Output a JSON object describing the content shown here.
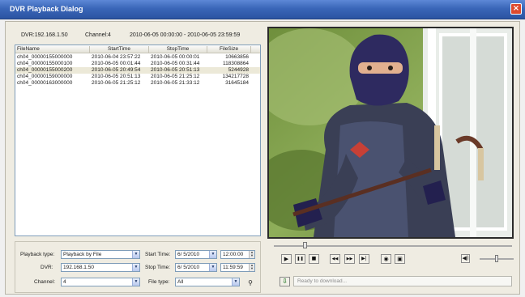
{
  "window": {
    "title": "DVR Playback Dialog",
    "close_glyph": "×"
  },
  "info": {
    "dvr": "DVR:192.168.1.50",
    "channel": "Channel:4",
    "range": "2010-06-05 00:00:00 - 2010-06-05 23:59:59"
  },
  "file_list": {
    "columns": [
      "FileName",
      "StartTime",
      "StopTime",
      "FileSize"
    ],
    "rows": [
      [
        "ch04_00000155000000",
        "2010-06-04 23:57:22",
        "2010-06-05 00:00:01",
        "10663856"
      ],
      [
        "ch04_00000155000100",
        "2010-06-05 00:01:44",
        "2010-06-05 00:31:44",
        "118308864"
      ],
      [
        "ch04_00000155000200",
        "2010-06-05 20:49:54",
        "2010-06-05 20:51:13",
        "5244928"
      ],
      [
        "ch04_00000159000000",
        "2010-06-05 20:51:13",
        "2010-06-05 21:25:12",
        "134217728"
      ],
      [
        "ch04_00000163000000",
        "2010-06-05 21:25:12",
        "2010-06-05 21:33:12",
        "31645184"
      ]
    ],
    "selected_row": 2
  },
  "search": {
    "playback_type_label": "Playback type:",
    "playback_type_value": "Playback by File",
    "dvr_label": "DVR:",
    "dvr_value": "192.168.1.50",
    "channel_label": "Channel:",
    "channel_value": "4",
    "start_time_label": "Start Time:",
    "start_date": "6/ 5/2010",
    "start_time": "12:00:00",
    "stop_time_label": "Stop Time:",
    "stop_date": "6/ 5/2010",
    "stop_time": "11:59:59",
    "file_type_label": "File type:",
    "file_type_value": "All",
    "search_glyph": "⚲"
  },
  "player": {
    "seek_fraction": 0.13,
    "volume_fraction": 0.5,
    "buttons": {
      "play": "▶",
      "pause": "❚❚",
      "stop": "■",
      "slow": "◀◀",
      "fast": "▶▶",
      "step": "▶|",
      "capture": "◉",
      "save": "▣",
      "volume": "◀)",
      "download": "⇩"
    },
    "status_text": "Ready to download..."
  },
  "colors": {
    "titlebar": "#3a66b8",
    "panel": "#efece2",
    "selection": "#ece9d8"
  }
}
